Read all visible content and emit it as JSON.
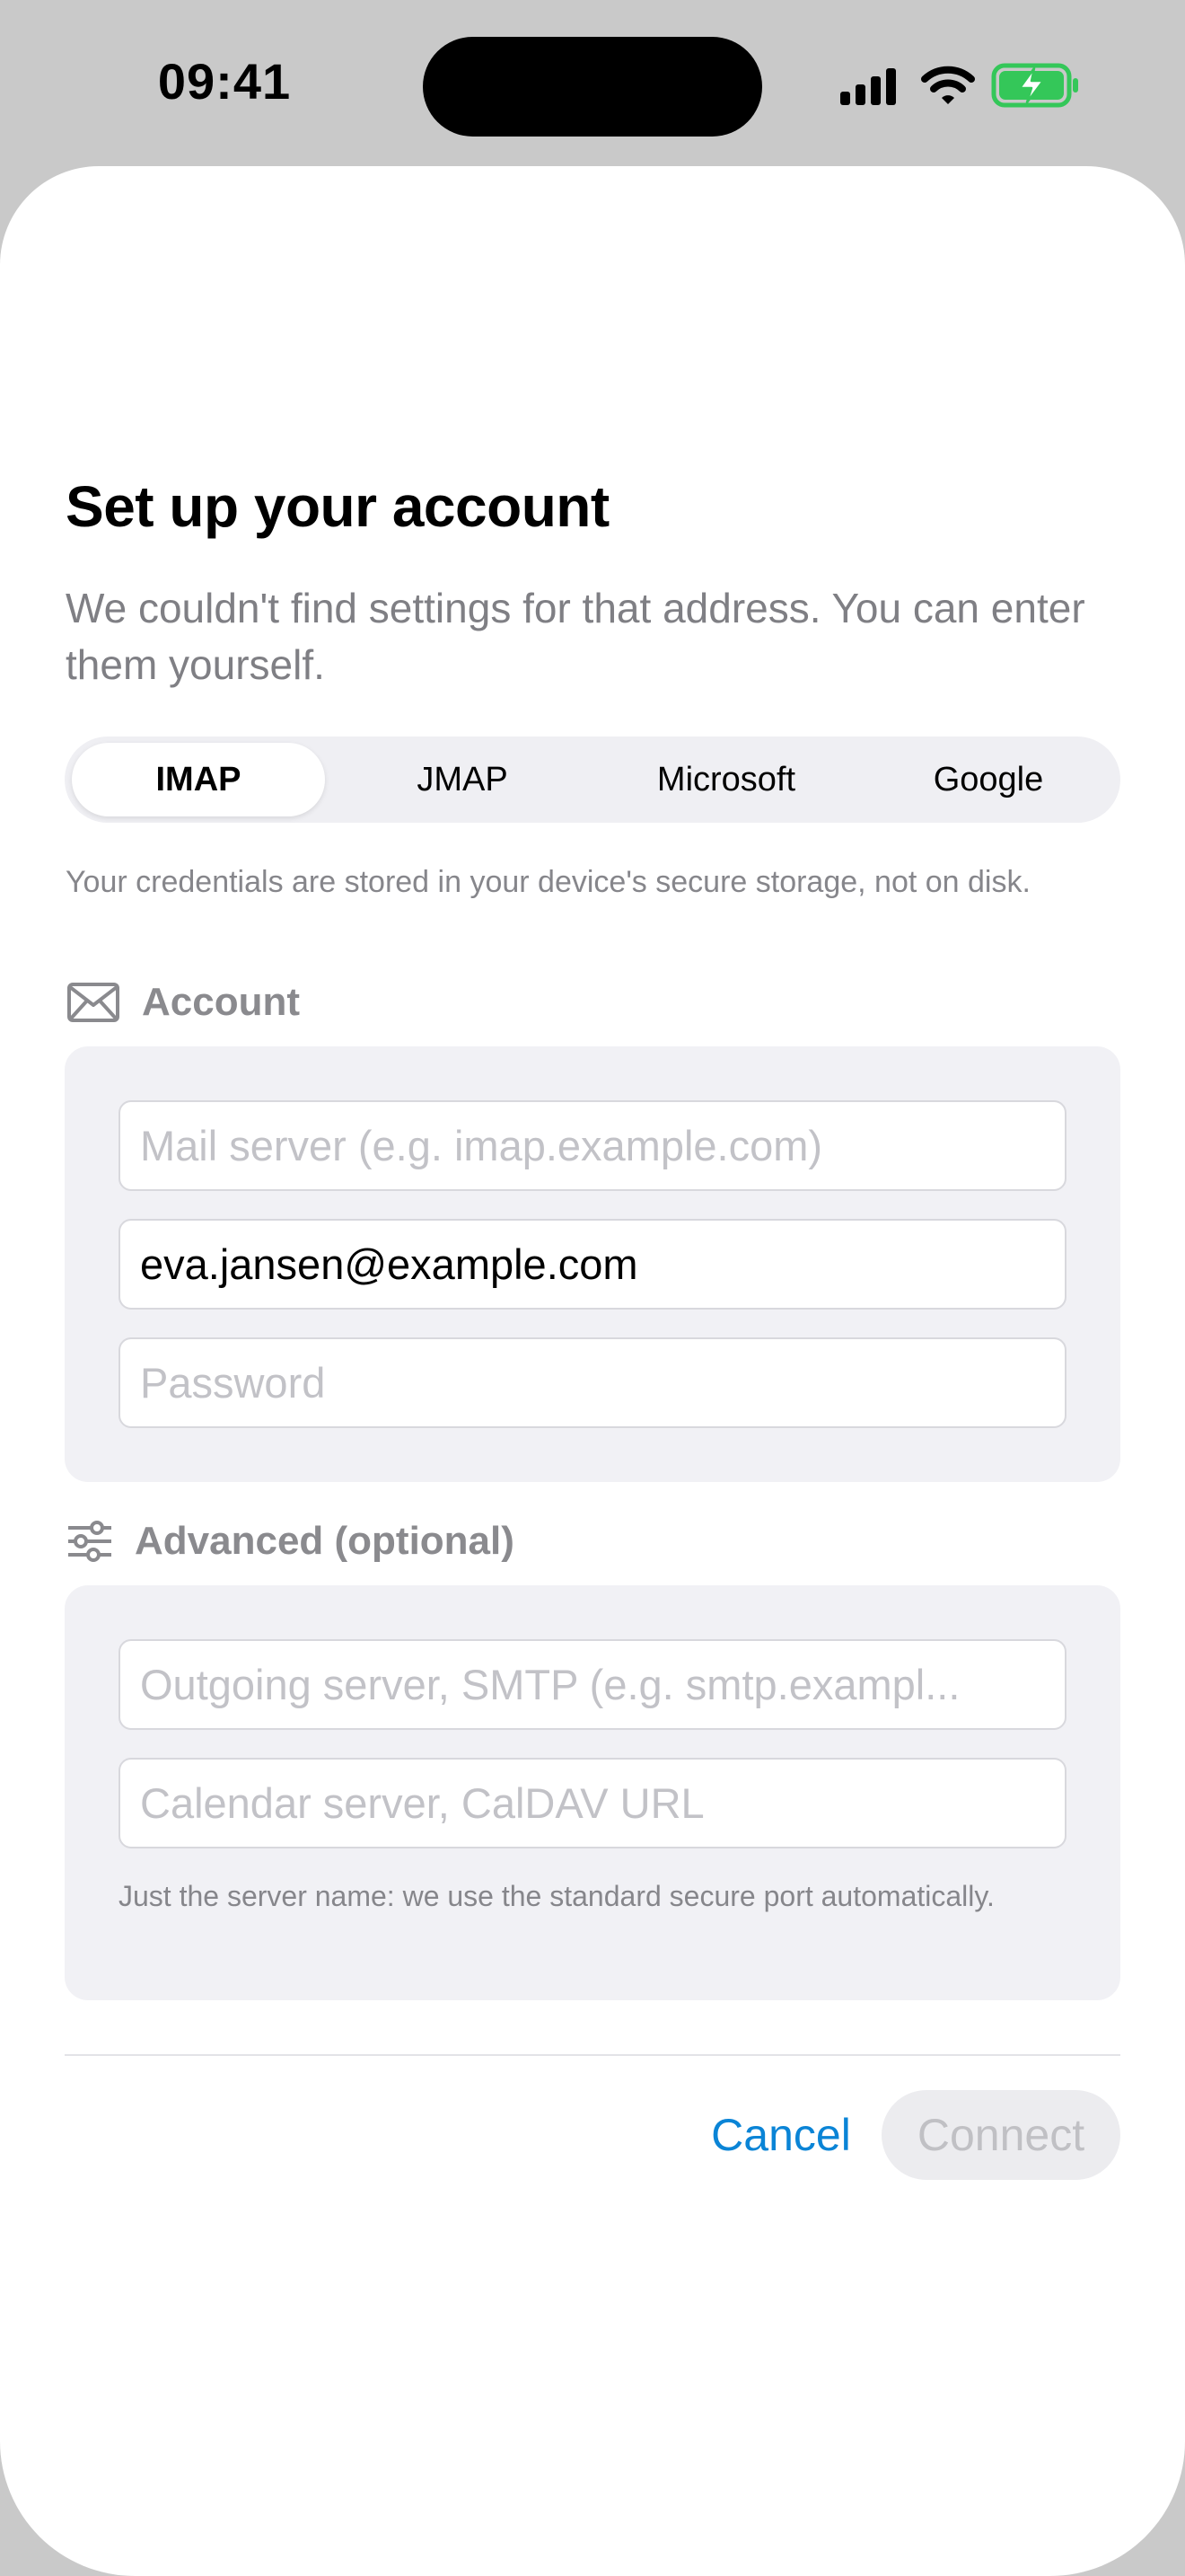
{
  "status_bar": {
    "time": "09:41"
  },
  "header": {
    "title": "Set up your account",
    "subtitle": "We couldn't find settings for that address. You can enter them yourself."
  },
  "protocol_tabs": [
    {
      "label": "IMAP",
      "selected": true
    },
    {
      "label": "JMAP",
      "selected": false
    },
    {
      "label": "Microsoft",
      "selected": false
    },
    {
      "label": "Google",
      "selected": false
    }
  ],
  "storage_note": "Your credentials are stored in your device's secure storage, not on disk.",
  "account_section": {
    "label": "Account",
    "icon": "envelope-icon",
    "mail_server": {
      "placeholder": "Mail server (e.g. imap.example.com)",
      "value": ""
    },
    "email": {
      "placeholder": "",
      "value": "eva.jansen@example.com"
    },
    "password": {
      "placeholder": "Password",
      "value": ""
    }
  },
  "advanced_section": {
    "label": "Advanced (optional)",
    "icon": "sliders-icon",
    "smtp_server": {
      "placeholder": "Outgoing server, SMTP (e.g. smtp.exampl...",
      "value": ""
    },
    "caldav_url": {
      "placeholder": "Calendar server, CalDAV URL",
      "value": ""
    },
    "hint": "Just the server name: we use the standard secure port automatically."
  },
  "actions": {
    "cancel_label": "Cancel",
    "connect_label": "Connect",
    "connect_enabled": false
  },
  "colors": {
    "accent": "#0a84d6",
    "battery": "#34c759",
    "group_background": "#f1f1f5",
    "backdrop": "#c9c9c9"
  }
}
